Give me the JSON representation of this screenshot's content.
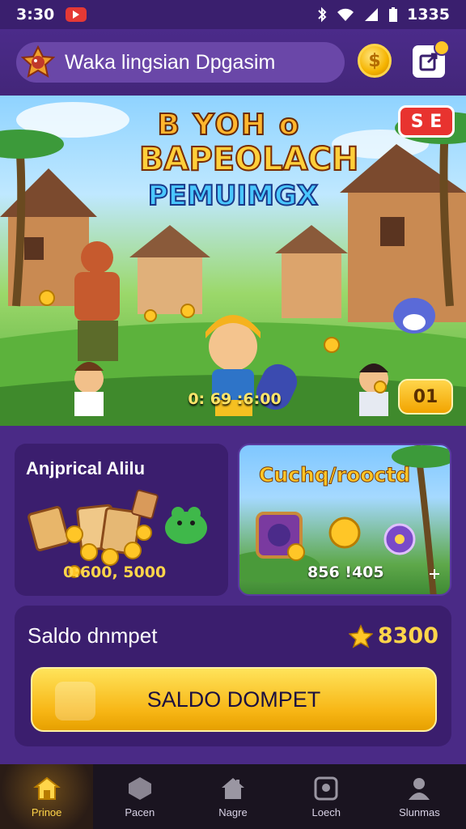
{
  "status_bar": {
    "time": "3:30",
    "battery_text": "1335"
  },
  "header": {
    "title": "Waka lingsian Dpgasim",
    "coin_symbol": "$"
  },
  "hero": {
    "title_line1": "B YOH o",
    "title_line2": "BAPEOLACH",
    "title_line3": "PEMUIMGX",
    "badge": "S E",
    "timer": "0: 69 :6:00",
    "counter": "01"
  },
  "card_left": {
    "title": "Anjprical Alilu",
    "value": "0:600, 5000"
  },
  "card_right": {
    "title": "Cuchq/rooctd",
    "value": "856 !405"
  },
  "wallet": {
    "label": "Saldo dnmpet",
    "amount": "8300",
    "button_label": "SALDO DOMPET"
  },
  "nav": {
    "items": [
      {
        "label": "Prinoe",
        "icon": "home-icon",
        "active": true
      },
      {
        "label": "Pacen",
        "icon": "hexagon-icon",
        "active": false
      },
      {
        "label": "Nagre",
        "icon": "house-icon",
        "active": false
      },
      {
        "label": "Loech",
        "icon": "square-face-icon",
        "active": false
      },
      {
        "label": "Slunmas",
        "icon": "person-icon",
        "active": false
      }
    ]
  },
  "colors": {
    "accent": "#ffd54a",
    "background": "#4a2a86",
    "panel": "#3b1e6e"
  }
}
